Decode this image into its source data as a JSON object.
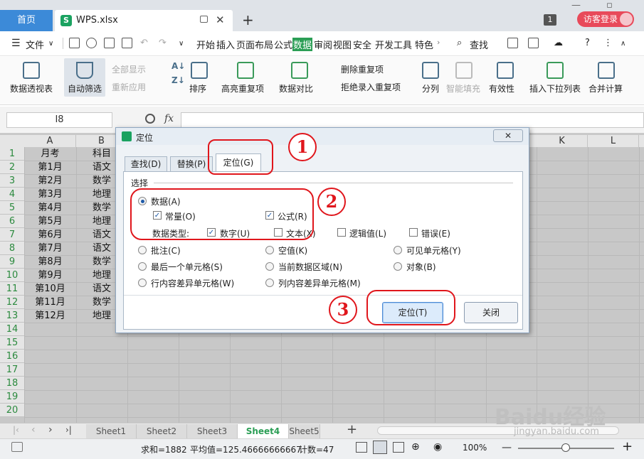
{
  "titlebar": {
    "home_tab": "首页",
    "file_tab": "WPS.xlsx",
    "file_icon": "S",
    "new_tab": "+",
    "count_badge": "1",
    "login": "访客登录"
  },
  "menu": {
    "file": "文件",
    "items": [
      "开始",
      "插入",
      "页面布局",
      "公式",
      "数据",
      "审阅",
      "视图",
      "安全",
      "开发工具",
      "特色"
    ],
    "active": "数据",
    "search": "查找"
  },
  "ribbon": {
    "pivot": "数据透视表",
    "autofilter": "自动筛选",
    "show_all": "全部显示",
    "reapply": "重新应用",
    "sort": "排序",
    "highlight_dup": "高亮重复项",
    "compare": "数据对比",
    "delete_dup": "删除重复项",
    "reject_dup": "拒绝录入重复项",
    "split": "分列",
    "smart_fill": "智能填充",
    "validity": "有效性",
    "insert_dropdown": "插入下拉列表",
    "consolidate": "合并计算"
  },
  "formula_bar": {
    "cell_ref": "I8",
    "fx": "fx",
    "value": ""
  },
  "sheet": {
    "columns": [
      "A",
      "B",
      "K",
      "L"
    ],
    "rows": [
      "1",
      "2",
      "3",
      "4",
      "5",
      "6",
      "7",
      "8",
      "9",
      "10",
      "11",
      "12",
      "13",
      "14",
      "15",
      "16",
      "17",
      "18",
      "19",
      "20"
    ],
    "colA": [
      "月考",
      "第1月",
      "第2月",
      "第3月",
      "第4月",
      "第5月",
      "第6月",
      "第7月",
      "第8月",
      "第9月",
      "第10月",
      "第11月",
      "第12月"
    ],
    "colB": [
      "科目",
      "语文",
      "数学",
      "地理",
      "数学",
      "地理",
      "语文",
      "语文",
      "数学",
      "地理",
      "语文",
      "数学",
      "地理"
    ]
  },
  "dialog": {
    "title": "定位",
    "close": "✕",
    "tabs": [
      "查找(D)",
      "替换(P)",
      "定位(G)"
    ],
    "group_label": "选择",
    "data": "数据(A)",
    "constant": "常量(O)",
    "formula": "公式(R)",
    "data_type": "数据类型:",
    "number": "数字(U)",
    "text": "文本(X)",
    "logical": "逻辑值(L)",
    "error": "错误(E)",
    "comment": "批注(C)",
    "blank": "空值(K)",
    "visible": "可见单元格(Y)",
    "last_cell": "最后一个单元格(S)",
    "current_region": "当前数据区域(N)",
    "object": "对象(B)",
    "row_diff": "行内容差异单元格(W)",
    "col_diff": "列内容差异单元格(M)",
    "locate_btn": "定位(T)",
    "close_btn": "关闭"
  },
  "annotations": {
    "one": "1",
    "two": "2",
    "three": "3"
  },
  "sheet_tabs": [
    "Sheet1",
    "Sheet2",
    "Sheet3",
    "Sheet4",
    "Sheet5"
  ],
  "active_sheet": "Sheet4",
  "status": {
    "sum": "求和=1882",
    "avg": "平均值=125.46666666667",
    "count": "计数=47",
    "zoom": "100%"
  },
  "watermark": {
    "brand": "Baidu经验",
    "url": "jingyan.baidu.com"
  },
  "colors": {
    "accent_green": "#2b9e55",
    "annotation_red": "#e0161c"
  }
}
